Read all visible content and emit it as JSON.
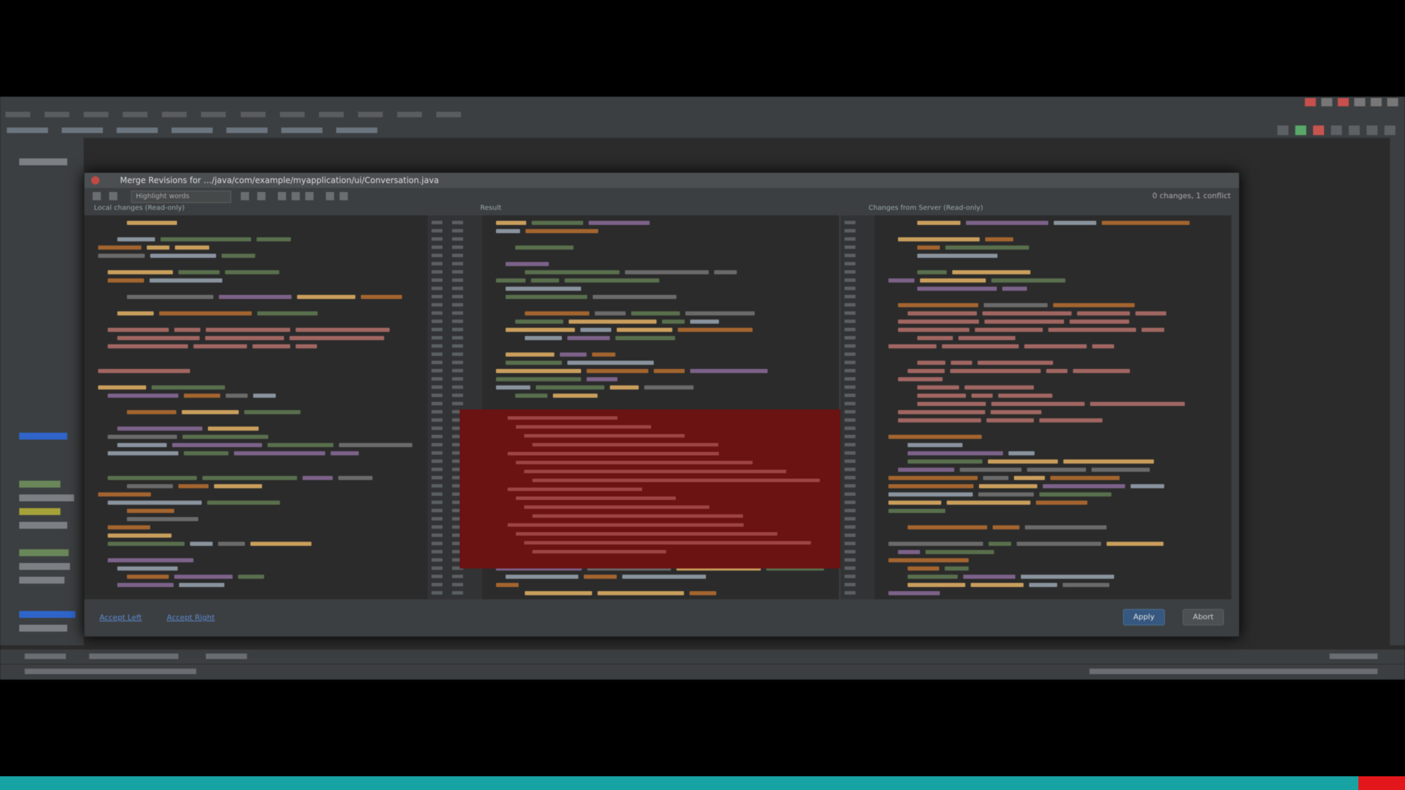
{
  "dialog": {
    "title": "Merge Revisions for …/java/com/example/myapplication/ui/Conversation.java",
    "side_combo": "Highlight words",
    "status": "0 changes, 1 conflict",
    "left_header": "Local changes (Read-only)",
    "center_header": "Result",
    "right_header": "Changes from Server (Read-only)",
    "accept_left": "Accept Left",
    "accept_right": "Accept Right",
    "apply_label": "Apply",
    "abort_label": "Abort"
  },
  "status_bar": {
    "left_text": "",
    "center_text": ""
  },
  "colors": {
    "ide_bg": "#2b2b2b",
    "panel": "#3c3f41",
    "conflict": "#6b1212",
    "keyword": "#cc7832",
    "string": "#6a8759",
    "accent_bottom_bar": "#17a2a4",
    "accent_red": "#e3171b"
  },
  "icons": [
    "close-icon",
    "arrow-left-icon",
    "arrow-right-icon",
    "settings-icon",
    "run-icon",
    "stop-icon"
  ]
}
